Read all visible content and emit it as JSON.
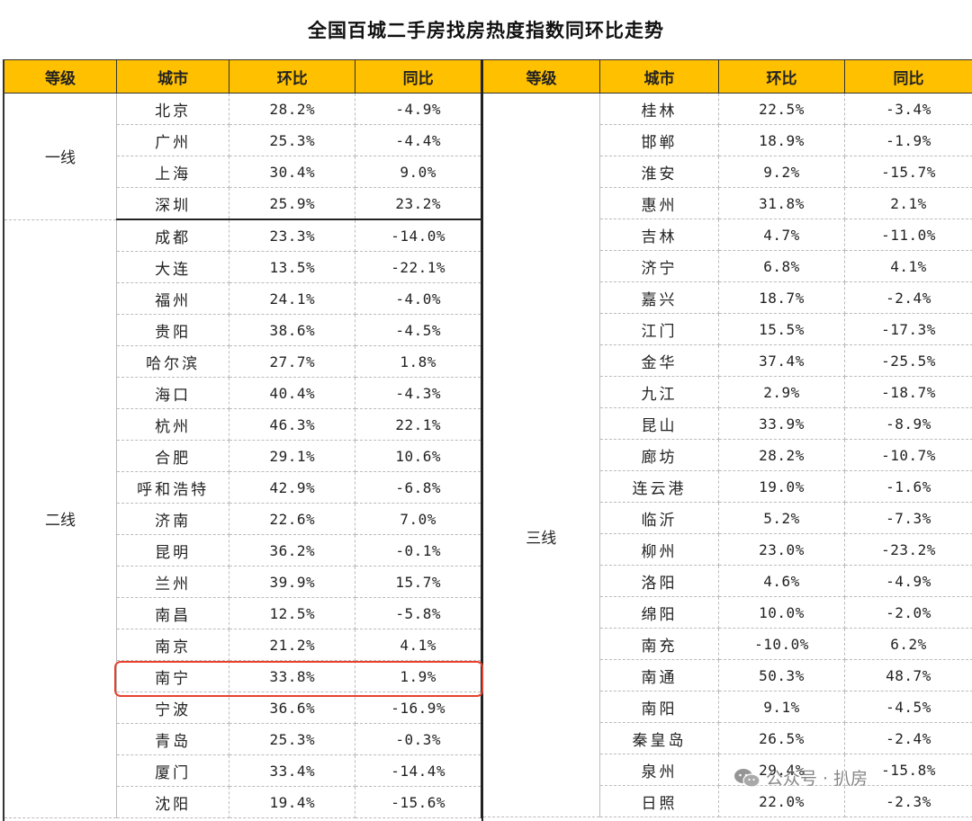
{
  "title": "全国百城二手房找房热度指数同环比走势",
  "headers": [
    "等级",
    "城市",
    "环比",
    "同比"
  ],
  "left": {
    "groups": [
      {
        "tier": "一线",
        "rows": [
          [
            "北京",
            "28.2%",
            "-4.9%"
          ],
          [
            "广州",
            "25.3%",
            "-4.4%"
          ],
          [
            "上海",
            "30.4%",
            "9.0%"
          ],
          [
            "深圳",
            "25.9%",
            "23.2%"
          ]
        ]
      },
      {
        "tier": "二线",
        "rows": [
          [
            "成都",
            "23.3%",
            "-14.0%"
          ],
          [
            "大连",
            "13.5%",
            "-22.1%"
          ],
          [
            "福州",
            "24.1%",
            "-4.0%"
          ],
          [
            "贵阳",
            "38.6%",
            "-4.5%"
          ],
          [
            "哈尔滨",
            "27.7%",
            "1.8%"
          ],
          [
            "海口",
            "40.4%",
            "-4.3%"
          ],
          [
            "杭州",
            "46.3%",
            "22.1%"
          ],
          [
            "合肥",
            "29.1%",
            "10.6%"
          ],
          [
            "呼和浩特",
            "42.9%",
            "-6.8%"
          ],
          [
            "济南",
            "22.6%",
            "7.0%"
          ],
          [
            "昆明",
            "36.2%",
            "-0.1%"
          ],
          [
            "兰州",
            "39.9%",
            "15.7%"
          ],
          [
            "南昌",
            "12.5%",
            "-5.8%"
          ],
          [
            "南京",
            "21.2%",
            "4.1%"
          ],
          [
            "南宁",
            "33.8%",
            "1.9%"
          ],
          [
            "宁波",
            "36.6%",
            "-16.9%"
          ],
          [
            "青岛",
            "25.3%",
            "-0.3%"
          ],
          [
            "厦门",
            "33.4%",
            "-14.4%"
          ],
          [
            "沈阳",
            "19.4%",
            "-15.6%"
          ]
        ]
      }
    ]
  },
  "right": {
    "tier": "三线",
    "rows": [
      [
        "桂林",
        "22.5%",
        "-3.4%"
      ],
      [
        "邯郸",
        "18.9%",
        "-1.9%"
      ],
      [
        "淮安",
        "9.2%",
        "-15.7%"
      ],
      [
        "惠州",
        "31.8%",
        "2.1%"
      ],
      [
        "吉林",
        "4.7%",
        "-11.0%"
      ],
      [
        "济宁",
        "6.8%",
        "4.1%"
      ],
      [
        "嘉兴",
        "18.7%",
        "-2.4%"
      ],
      [
        "江门",
        "15.5%",
        "-17.3%"
      ],
      [
        "金华",
        "37.4%",
        "-25.5%"
      ],
      [
        "九江",
        "2.9%",
        "-18.7%"
      ],
      [
        "昆山",
        "33.9%",
        "-8.9%"
      ],
      [
        "廊坊",
        "28.2%",
        "-10.7%"
      ],
      [
        "连云港",
        "19.0%",
        "-1.6%"
      ],
      [
        "临沂",
        "5.2%",
        "-7.3%"
      ],
      [
        "柳州",
        "23.0%",
        "-23.2%"
      ],
      [
        "洛阳",
        "4.6%",
        "-4.9%"
      ],
      [
        "绵阳",
        "10.0%",
        "-2.0%"
      ],
      [
        "南充",
        "-10.0%",
        "6.2%"
      ],
      [
        "南通",
        "50.3%",
        "48.7%"
      ],
      [
        "南阳",
        "9.1%",
        "-4.5%"
      ],
      [
        "秦皇岛",
        "26.5%",
        "-2.4%"
      ],
      [
        "泉州",
        "29.4%",
        "-15.8%"
      ],
      [
        "日照",
        "22.0%",
        "-2.3%"
      ]
    ]
  },
  "highlight": {
    "city": "南宁",
    "color": "#E8422F"
  },
  "watermark": {
    "icon": "wechat-icon",
    "text": "公众号 · 扒房"
  },
  "colors": {
    "header_bg": "#FFC000",
    "highlight_border": "#E8422F"
  }
}
